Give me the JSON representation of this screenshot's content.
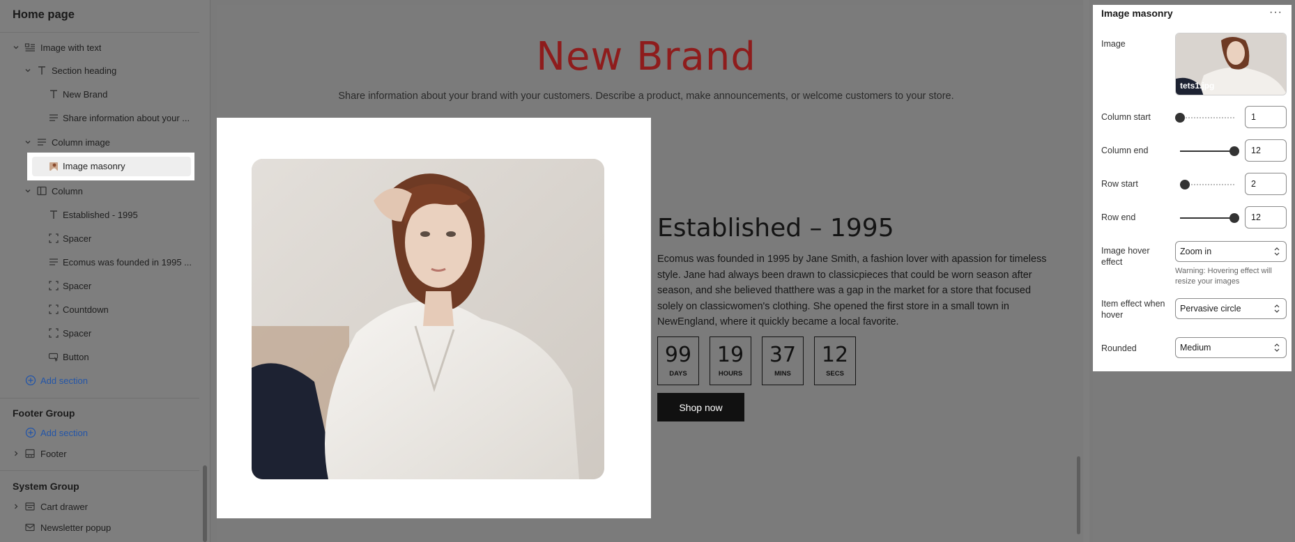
{
  "sidebar": {
    "title": "Home page",
    "tree": [
      {
        "label": "Image with text",
        "icon": "image-text-icon",
        "expanded": true
      },
      {
        "label": "Section heading",
        "icon": "text-icon",
        "expanded": true
      },
      {
        "label": "New Brand",
        "icon": "text-icon"
      },
      {
        "label": "Share information about your ...",
        "icon": "paragraph-icon"
      },
      {
        "label": "Column image",
        "icon": "paragraph-icon",
        "expanded": true
      },
      {
        "label": "Image masonry",
        "icon": "image-icon",
        "selected": true
      },
      {
        "label": "Column",
        "icon": "column-icon",
        "expanded": true
      },
      {
        "label": "Established - 1995",
        "icon": "text-icon"
      },
      {
        "label": "Spacer",
        "icon": "spacer-icon"
      },
      {
        "label": "Ecomus was founded in 1995 ...",
        "icon": "paragraph-icon"
      },
      {
        "label": "Spacer",
        "icon": "spacer-icon"
      },
      {
        "label": "Countdown",
        "icon": "spacer-icon"
      },
      {
        "label": "Spacer",
        "icon": "spacer-icon"
      },
      {
        "label": "Button",
        "icon": "button-icon"
      }
    ],
    "add_section": "Add section",
    "footer_group": {
      "title": "Footer Group",
      "add_section": "Add section",
      "items": [
        {
          "label": "Footer",
          "icon": "footer-icon"
        }
      ]
    },
    "system_group": {
      "title": "System Group",
      "items": [
        {
          "label": "Cart drawer",
          "icon": "cart-icon"
        },
        {
          "label": "Newsletter popup",
          "icon": "mail-icon"
        }
      ]
    }
  },
  "preview": {
    "title": "New Brand",
    "subtitle": "Share information about your brand with your customers. Describe a product, make announcements, or welcome customers to your store.",
    "established": "Established – 1995",
    "body": "Ecomus was founded in 1995 by Jane Smith, a fashion lover with apassion for timeless style. Jane had always been drawn to classicpieces that could be worn season after season, and she believed thatthere was a gap in the market for a store that focused solely on classicwomen's clothing. She opened the first store in a small town in NewEngland, where it quickly became a local favorite.",
    "countdown": [
      {
        "value": "99",
        "unit": "DAYS"
      },
      {
        "value": "19",
        "unit": "HOURS"
      },
      {
        "value": "37",
        "unit": "MINS"
      },
      {
        "value": "12",
        "unit": "SECS"
      }
    ],
    "button": "Shop now",
    "title_color": "#8e1c1c"
  },
  "panel": {
    "title": "Image masonry",
    "more": "···",
    "image_label": "Image",
    "image_name": "tets1.jpg",
    "sliders": [
      {
        "label": "Column start",
        "value": "1",
        "fraction": 0.0
      },
      {
        "label": "Column end",
        "value": "12",
        "fraction": 1.0
      },
      {
        "label": "Row start",
        "value": "2",
        "fraction": 0.09
      },
      {
        "label": "Row end",
        "value": "12",
        "fraction": 1.0
      }
    ],
    "hover_effect": {
      "label": "Image hover effect",
      "value": "Zoom in",
      "warning": "Warning: Hovering effect will resize your images"
    },
    "item_effect": {
      "label": "Item effect when hover",
      "value": "Pervasive circle"
    },
    "rounded": {
      "label": "Rounded",
      "value": "Medium"
    }
  }
}
